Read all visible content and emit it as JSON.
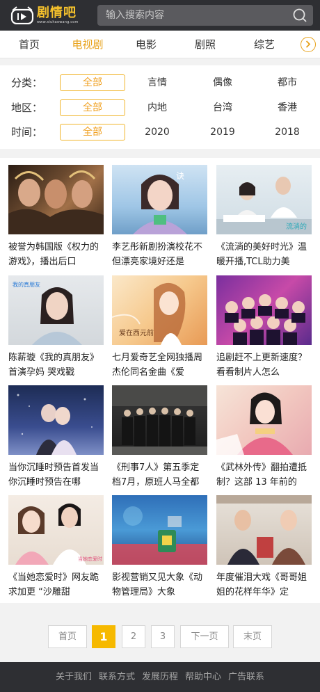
{
  "header": {
    "logo_title": "剧情吧",
    "logo_domain": "www.xiuhaowang.com",
    "search_placeholder": "输入搜索内容"
  },
  "nav": {
    "items": [
      "首页",
      "电视剧",
      "电影",
      "剧照",
      "综艺"
    ],
    "active_index": 1
  },
  "filters": [
    {
      "label": "分类：",
      "options": [
        "全部",
        "言情",
        "偶像",
        "都市"
      ],
      "active_index": 0
    },
    {
      "label": "地区：",
      "options": [
        "全部",
        "内地",
        "台湾",
        "香港"
      ],
      "active_index": 0
    },
    {
      "label": "时间：",
      "options": [
        "全部",
        "2020",
        "2019",
        "2018"
      ],
      "active_index": 0
    }
  ],
  "articles": [
    {
      "caption": "被誉为韩国版《权力的游戏》，播出后口"
    },
    {
      "caption": "李艺彤新剧扮演校花不但漂亮家境好还是"
    },
    {
      "caption": "《流淌的美好时光》温暖开播,TCL助力美"
    },
    {
      "caption": "陈薪璇《我的真朋友》 首演孕妈 哭戏戳"
    },
    {
      "caption": "七月爱奇艺全网独播周杰伦同名金曲《爱"
    },
    {
      "caption": "追剧赶不上更新速度？看看制片人怎么"
    },
    {
      "caption": "当你沉睡时预告首发当你沉睡时预告在哪"
    },
    {
      "caption": "《刑事7人》第五季定档7月，原班人马全都"
    },
    {
      "caption": "《武林外传》翻拍遭抵制？这部 13 年前的"
    },
    {
      "caption": "《当她恋爱时》网友跪求加更 “沙雕甜"
    },
    {
      "caption": "影视营销又见大象《动物管理局》大象"
    },
    {
      "caption": "年度催泪大戏《哥哥姐姐的花样年华》定"
    }
  ],
  "pagination": {
    "first": "首页",
    "pages": [
      "1",
      "2",
      "3"
    ],
    "active_page": "1",
    "next": "下一页",
    "last": "末页"
  },
  "footer": {
    "links": [
      "关于我们",
      "联系方式",
      "发展历程",
      "帮助中心",
      "广告联系"
    ]
  },
  "colors": {
    "header_bg": "#2e2f33",
    "accent": "#e8a21a",
    "pager_active": "#f6b900"
  }
}
